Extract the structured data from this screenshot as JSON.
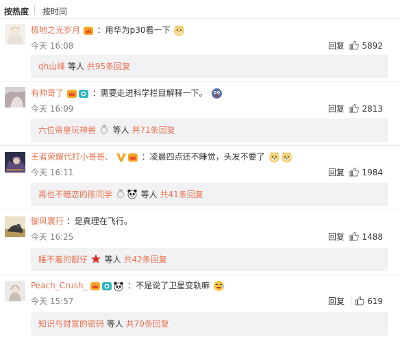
{
  "sort": {
    "hot": "按热度",
    "time": "按时间"
  },
  "comments": [
    {
      "user": "极地之光岁月",
      "text": "：用华为p30看一下",
      "time": "今天 16:08",
      "reply_label": "回复",
      "likes": "5892",
      "sub": {
        "name": "qh山峰",
        "mid": " 等人 ",
        "count": "共95条回复"
      }
    },
    {
      "user": "有帅哥了",
      "text": "：需要走进科学栏目解释一下。",
      "time": "今天 16:09",
      "reply_label": "回复",
      "likes": "2813",
      "sub": {
        "name": "六位帝皇玩神兽",
        "mid": " 等人 ",
        "count": "共71条回复"
      }
    },
    {
      "user": "王者荣耀代打小哥哥、",
      "text": "：凌晨四点还不睡觉，头发不要了",
      "time": "今天 16:11",
      "reply_label": "回复",
      "likes": "1984",
      "sub": {
        "name": "再也不暗恋的陈同学",
        "mid": " 等人 ",
        "count": "共41条回复"
      }
    },
    {
      "user": "御风寰行",
      "text": "：是真理在飞行。",
      "time": "今天 16:25",
      "reply_label": "回复",
      "likes": "1488",
      "sub": {
        "name": "睡不着的靓仔",
        "mid": " 等人 ",
        "count": "共42条回复"
      }
    },
    {
      "user": "Peach_Crush_",
      "text": "：不是说了卫星变轨嘛",
      "time": "今天 15:57",
      "reply_label": "回复",
      "likes": "619",
      "sub": {
        "name": "知识与财富的密码",
        "mid": " 等人 ",
        "count": "共70条回复"
      }
    }
  ],
  "colors": {
    "username": "#eb7350",
    "time": "#808080",
    "subbox": "#f2f2f5",
    "text": "#333333"
  }
}
